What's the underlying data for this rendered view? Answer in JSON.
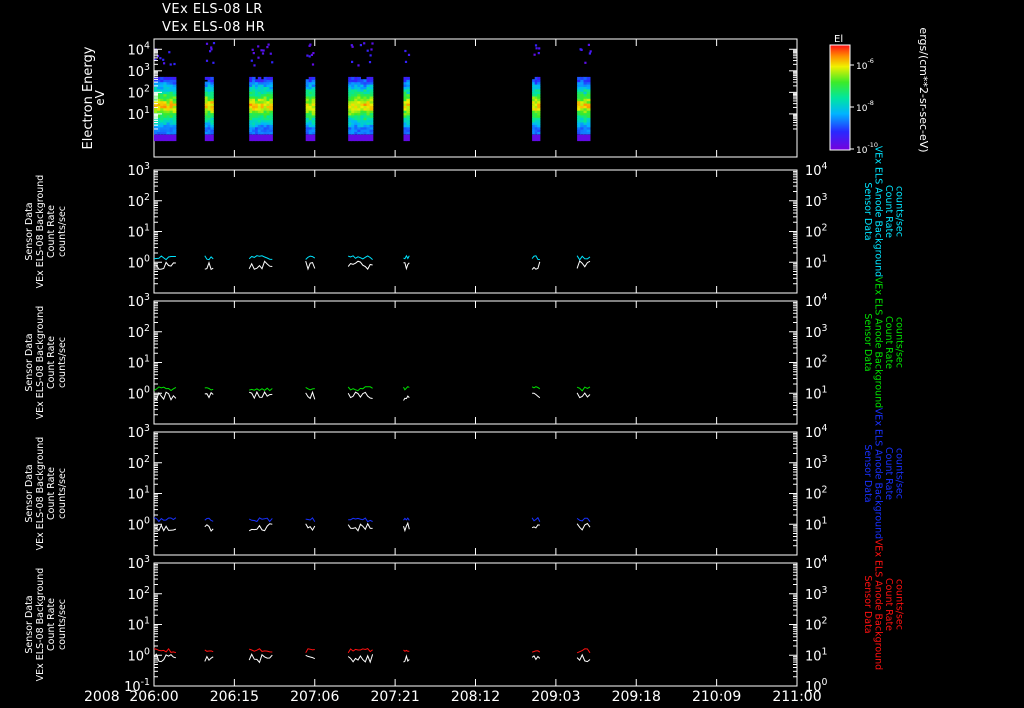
{
  "titles": [
    "VEx ELS-08 LR",
    "VEx ELS-08 HR"
  ],
  "year": "2008",
  "colors": {
    "white": "#ffffff",
    "cyan": "#00e5ff",
    "green": "#00e000",
    "blue": "#1830ff",
    "red": "#ff1010"
  },
  "spectrogram": {
    "ylabel": "Electron Energy",
    "yunit": "eV",
    "yticks": [
      "10^4",
      "10^3",
      "10^2",
      "10^1"
    ],
    "colorbar_title": "El",
    "colorbar_ticks": [
      "10^-6",
      "10^-8",
      "10^-10"
    ],
    "colorbar_label": "ergs/(cm**2-sr-sec-eV)"
  },
  "panels": [
    {
      "left_label": [
        "Sensor Data",
        "VEx ELS-08 Background",
        "Count Rate",
        "counts/sec"
      ],
      "right_label": [
        "Sensor Data",
        "VEx ELS Anode Background",
        "Count Rate",
        "counts/sec"
      ],
      "left_ticks": [
        "10^3",
        "10^2",
        "10^1",
        "10^0"
      ],
      "right_ticks": [
        "10^4",
        "10^3",
        "10^2",
        "10^1"
      ],
      "color_key": "cyan"
    },
    {
      "left_label": [
        "Sensor Data",
        "VEx ELS-08 Background",
        "Count Rate",
        "counts/sec"
      ],
      "right_label": [
        "Sensor Data",
        "VEx ELS Anode Background",
        "Count Rate",
        "counts/sec"
      ],
      "left_ticks": [
        "10^3",
        "10^2",
        "10^1",
        "10^0"
      ],
      "right_ticks": [
        "10^4",
        "10^3",
        "10^2",
        "10^1"
      ],
      "color_key": "green"
    },
    {
      "left_label": [
        "Sensor Data",
        "VEx ELS-08 Background",
        "Count Rate",
        "counts/sec"
      ],
      "right_label": [
        "Sensor Data",
        "VEx ELS Anode Background",
        "Count Rate",
        "counts/sec"
      ],
      "left_ticks": [
        "10^3",
        "10^2",
        "10^1",
        "10^0"
      ],
      "right_ticks": [
        "10^4",
        "10^3",
        "10^2",
        "10^1"
      ],
      "color_key": "blue"
    },
    {
      "left_label": [
        "Sensor Data",
        "VEx ELS-08 Background",
        "Count Rate",
        "counts/sec"
      ],
      "right_label": [
        "Sensor Data",
        "VEx ELS Anode Background",
        "Count Rate",
        "counts/sec"
      ],
      "left_ticks": [
        "10^3",
        "10^2",
        "10^1",
        "10^0",
        "10^-1"
      ],
      "right_ticks": [
        "10^4",
        "10^3",
        "10^2",
        "10^1",
        "10^0"
      ],
      "color_key": "red"
    }
  ],
  "x_ticks": [
    "206:00",
    "206:15",
    "207:06",
    "207:21",
    "208:12",
    "209:03",
    "209:18",
    "210:09",
    "211:00"
  ],
  "chart_data": {
    "type": "line",
    "x_range": [
      "206:00",
      "211:00"
    ],
    "y_scale": "log",
    "spectrogram_ylim": [
      0.1,
      30000
    ],
    "count_rate_ylim": [
      0.1,
      1000
    ],
    "data_intervals": [
      {
        "start": 206.0,
        "end": 206.17
      },
      {
        "start": 206.395,
        "end": 206.46
      },
      {
        "start": 206.74,
        "end": 206.92
      },
      {
        "start": 207.18,
        "end": 207.25
      },
      {
        "start": 207.51,
        "end": 207.7
      },
      {
        "start": 207.94,
        "end": 207.985
      },
      {
        "start": 208.94,
        "end": 209.0
      },
      {
        "start": 209.29,
        "end": 209.39
      }
    ],
    "series_levels": {
      "white": 0.8,
      "colored": 1.4
    }
  }
}
